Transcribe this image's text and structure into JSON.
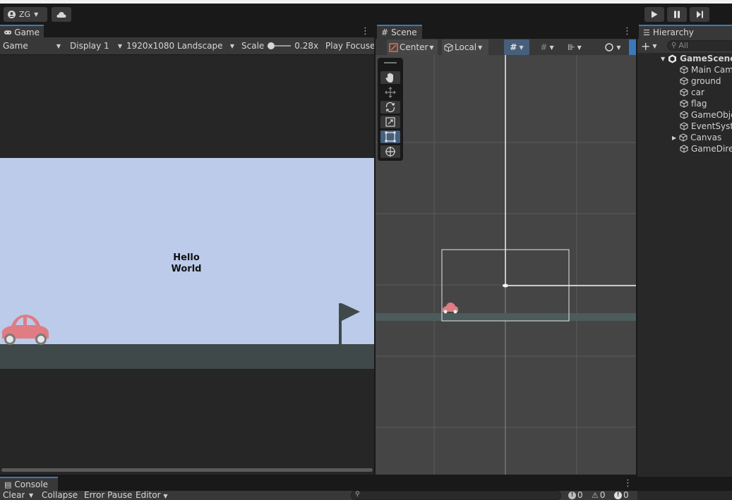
{
  "toolbar": {
    "account_label": "ZG",
    "play_icon": "play-icon",
    "pause_icon": "pause-icon",
    "step_icon": "step-icon"
  },
  "game": {
    "tab_label": "Game",
    "view_mode": "Game",
    "display": "Display 1",
    "resolution": "1920x1080 Landscape",
    "scale_label": "Scale",
    "scale_value": "0.28x",
    "play_focus": "Play Focuse",
    "hello_line1": "Hello",
    "hello_line2": "World"
  },
  "scene": {
    "tab_label": "Scene",
    "pivot_mode": "Center",
    "pivot_rotation": "Local"
  },
  "hierarchy": {
    "tab_label": "Hierarchy",
    "search_placeholder": "All",
    "scene_name": "GameScene",
    "items": [
      {
        "label": "Main Cam"
      },
      {
        "label": "ground"
      },
      {
        "label": "car"
      },
      {
        "label": "flag"
      },
      {
        "label": "GameObje"
      },
      {
        "label": "EventSyst"
      },
      {
        "label": "Canvas"
      },
      {
        "label": "GameDire"
      }
    ]
  },
  "console": {
    "tab_label": "Console",
    "clear": "Clear",
    "collapse": "Collapse",
    "error_pause": "Error Pause",
    "editor": "Editor",
    "log_count": "0",
    "warning_count": "0",
    "error_count": "0"
  },
  "colors": {
    "sky": "#bccbe9",
    "ground": "#3f4949",
    "car": "#e07c84",
    "flag": "#3f4949",
    "accent": "#3a79bb"
  }
}
